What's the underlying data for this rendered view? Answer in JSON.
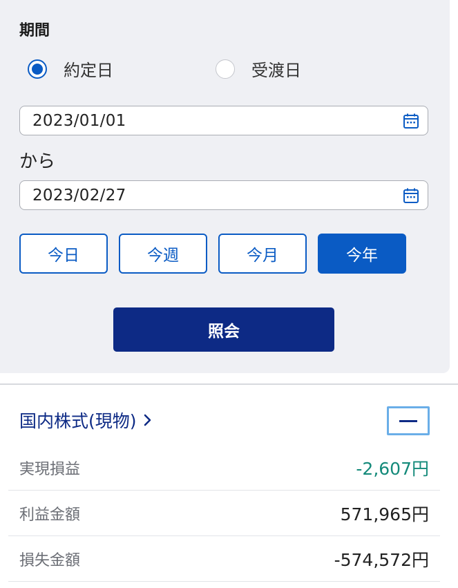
{
  "period": {
    "title": "期間",
    "radio": [
      {
        "label": "約定日",
        "checked": true
      },
      {
        "label": "受渡日",
        "checked": false
      }
    ],
    "from_date": "2023/01/01",
    "separator": "から",
    "to_date": "2023/02/27",
    "quick_buttons": [
      {
        "label": "今日",
        "active": false
      },
      {
        "label": "今週",
        "active": false
      },
      {
        "label": "今月",
        "active": false
      },
      {
        "label": "今年",
        "active": true
      }
    ],
    "query_button": "照会"
  },
  "summary": {
    "section_link": "国内株式(現物)",
    "rows": [
      {
        "label": "実現損益",
        "value": "-2,607円"
      },
      {
        "label": "利益金額",
        "value": "571,965円"
      },
      {
        "label": "損失金額",
        "value": "-574,572円"
      }
    ]
  },
  "colors": {
    "accent": "#0a5bc4",
    "primary_dark": "#0d2a85",
    "panel_bg": "#eff0f4",
    "gain_loss_value": "#148a7a"
  },
  "icons": {
    "date_picker": "calendar-icon",
    "link": "chevron-right-icon",
    "collapse": "minus-icon"
  }
}
